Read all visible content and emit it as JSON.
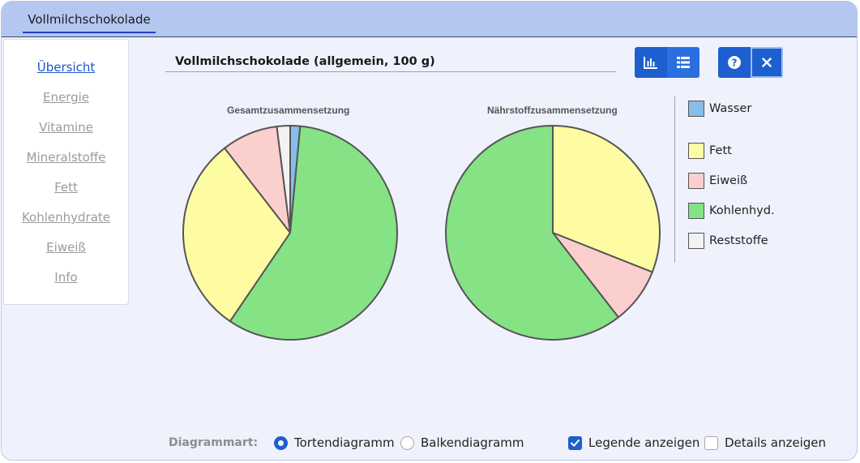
{
  "tab": {
    "label": "Vollmilchschokolade"
  },
  "sidebar": {
    "items": [
      {
        "label": "Übersicht",
        "active": true
      },
      {
        "label": "Energie"
      },
      {
        "label": "Vitamine"
      },
      {
        "label": "Mineralstoffe"
      },
      {
        "label": "Fett"
      },
      {
        "label": "Kohlenhydrate"
      },
      {
        "label": "Eiweiß"
      },
      {
        "label": "Info"
      }
    ]
  },
  "header": {
    "title": "Vollmilchschokolade (allgemein, 100 g)"
  },
  "toolbar": {
    "view_buttons": [
      "bar-chart-icon",
      "table-icon"
    ],
    "help_icon": "question-circle-icon",
    "close_icon": "close-icon"
  },
  "colors": {
    "Wasser": "#86bde9",
    "Fett": "#fdfca3",
    "Eiweiß": "#fccfcf",
    "Kohlenhyd.": "#85e285",
    "Reststoffe": "#f2f2f2",
    "accent": "#1d5fcf"
  },
  "chart_data": [
    {
      "type": "pie",
      "title": "Gesamtzusammensetzung",
      "slices": [
        {
          "name": "Wasser",
          "value": 1.5
        },
        {
          "name": "Kohlenhyd.",
          "value": 58
        },
        {
          "name": "Fett",
          "value": 30
        },
        {
          "name": "Eiweiß",
          "value": 8.5
        },
        {
          "name": "Reststoffe",
          "value": 2
        }
      ]
    },
    {
      "type": "pie",
      "title": "Nährstoffzusammensetzung",
      "slices": [
        {
          "name": "Fett",
          "value": 31
        },
        {
          "name": "Eiweiß",
          "value": 8.5
        },
        {
          "name": "Kohlenhyd.",
          "value": 60.5
        }
      ]
    }
  ],
  "legend": {
    "items": [
      {
        "label": "Wasser"
      },
      {
        "label": "Fett"
      },
      {
        "label": "Eiweiß"
      },
      {
        "label": "Kohlenhyd."
      },
      {
        "label": "Reststoffe"
      }
    ]
  },
  "options": {
    "diagrammart_label": "Diagrammart:",
    "radio_pie": {
      "label": "Tortendiagramm",
      "checked": true
    },
    "radio_bar": {
      "label": "Balkendiagramm",
      "checked": false
    },
    "check_legend": {
      "label": "Legende anzeigen",
      "checked": true
    },
    "check_details": {
      "label": "Details anzeigen",
      "checked": false
    }
  }
}
